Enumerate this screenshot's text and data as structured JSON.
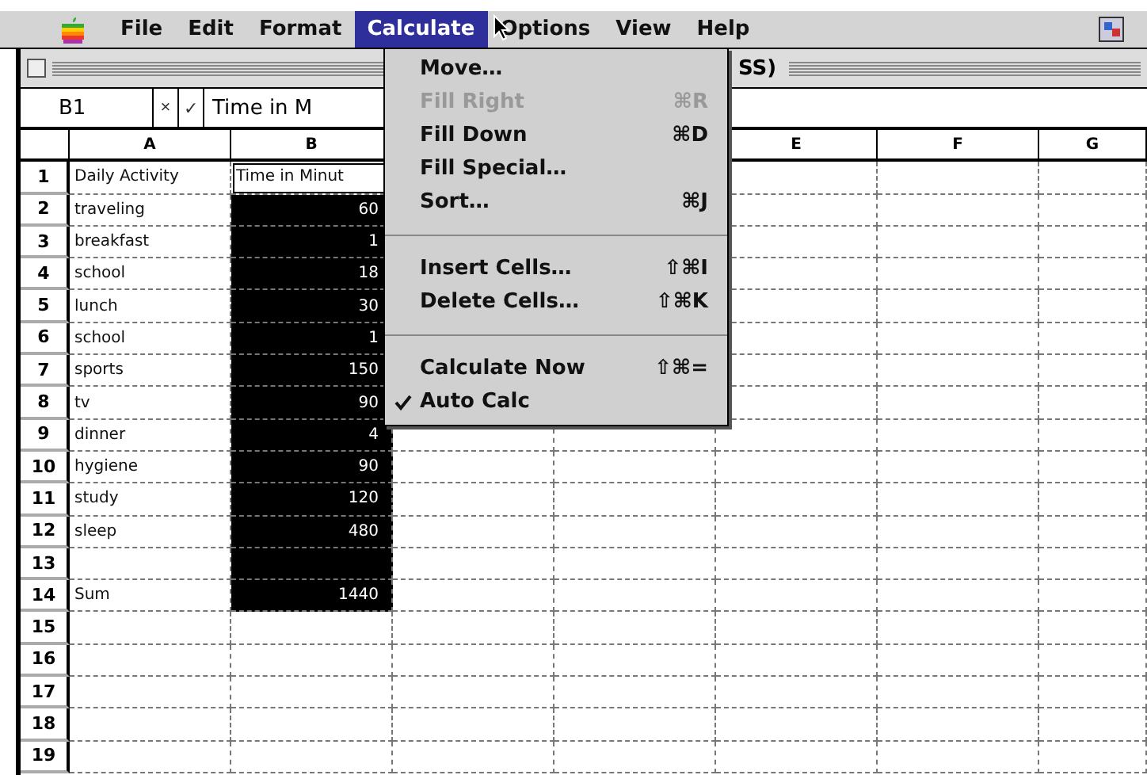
{
  "menubar": [
    {
      "label": "File",
      "selected": false
    },
    {
      "label": "Edit",
      "selected": false
    },
    {
      "label": "Format",
      "selected": false
    },
    {
      "label": "Calculate",
      "selected": true
    },
    {
      "label": "Options",
      "selected": false
    },
    {
      "label": "View",
      "selected": false
    },
    {
      "label": "Help",
      "selected": false
    }
  ],
  "window": {
    "title": "SS)"
  },
  "formula_bar": {
    "cell": "B1",
    "cancel": "×",
    "accept": "✓",
    "value": "Time in M"
  },
  "columns": [
    "A",
    "B",
    "",
    "",
    "E",
    "F",
    "G"
  ],
  "rows": [
    {
      "num": "1",
      "a": "Daily Activity",
      "b": "Time in Minut",
      "selected": false
    },
    {
      "num": "2",
      "a": "traveling",
      "b": "60",
      "selected": true
    },
    {
      "num": "3",
      "a": "breakfast",
      "b": "1",
      "selected": true
    },
    {
      "num": "4",
      "a": "school",
      "b": "18",
      "selected": true
    },
    {
      "num": "5",
      "a": "lunch",
      "b": "30",
      "selected": true
    },
    {
      "num": "6",
      "a": "school",
      "b": "1",
      "selected": true
    },
    {
      "num": "7",
      "a": "sports",
      "b": "150",
      "selected": true
    },
    {
      "num": "8",
      "a": "tv",
      "b": "90",
      "selected": true
    },
    {
      "num": "9",
      "a": "dinner",
      "b": "4",
      "selected": true
    },
    {
      "num": "10",
      "a": "hygiene",
      "b": "90",
      "selected": true
    },
    {
      "num": "11",
      "a": "study",
      "b": "120",
      "selected": true
    },
    {
      "num": "12",
      "a": "sleep",
      "b": "480",
      "selected": true
    },
    {
      "num": "13",
      "selected": true
    },
    {
      "num": "14",
      "a": "Sum",
      "b": "1440",
      "selected": true
    },
    {
      "num": "15",
      "selected": false
    },
    {
      "num": "16",
      "selected": false
    },
    {
      "num": "17",
      "selected": false
    },
    {
      "num": "18",
      "selected": false
    },
    {
      "num": "19",
      "selected": false
    }
  ],
  "menu": [
    {
      "kind": "item",
      "label": "Move…",
      "disabled": false,
      "checked": false
    },
    {
      "kind": "item",
      "label": "Fill Right",
      "shortcut": "⌘R",
      "disabled": true,
      "checked": false
    },
    {
      "kind": "item",
      "label": "Fill Down",
      "shortcut": "⌘D",
      "disabled": false,
      "checked": false
    },
    {
      "kind": "item",
      "label": "Fill Special…",
      "disabled": false,
      "checked": false
    },
    {
      "kind": "item",
      "label": "Sort…",
      "shortcut": "⌘J",
      "disabled": false,
      "checked": false
    },
    {
      "kind": "separator"
    },
    {
      "kind": "item",
      "label": "Insert Cells…",
      "shortcut": "⇧⌘I",
      "disabled": false,
      "checked": false
    },
    {
      "kind": "item",
      "label": "Delete Cells…",
      "shortcut": "⇧⌘K",
      "disabled": false,
      "checked": false
    },
    {
      "kind": "separator"
    },
    {
      "kind": "item",
      "label": "Calculate Now",
      "shortcut": "⇧⌘=",
      "disabled": false,
      "checked": false
    },
    {
      "kind": "item",
      "label": "Auto Calc",
      "disabled": false,
      "checked": true
    }
  ]
}
